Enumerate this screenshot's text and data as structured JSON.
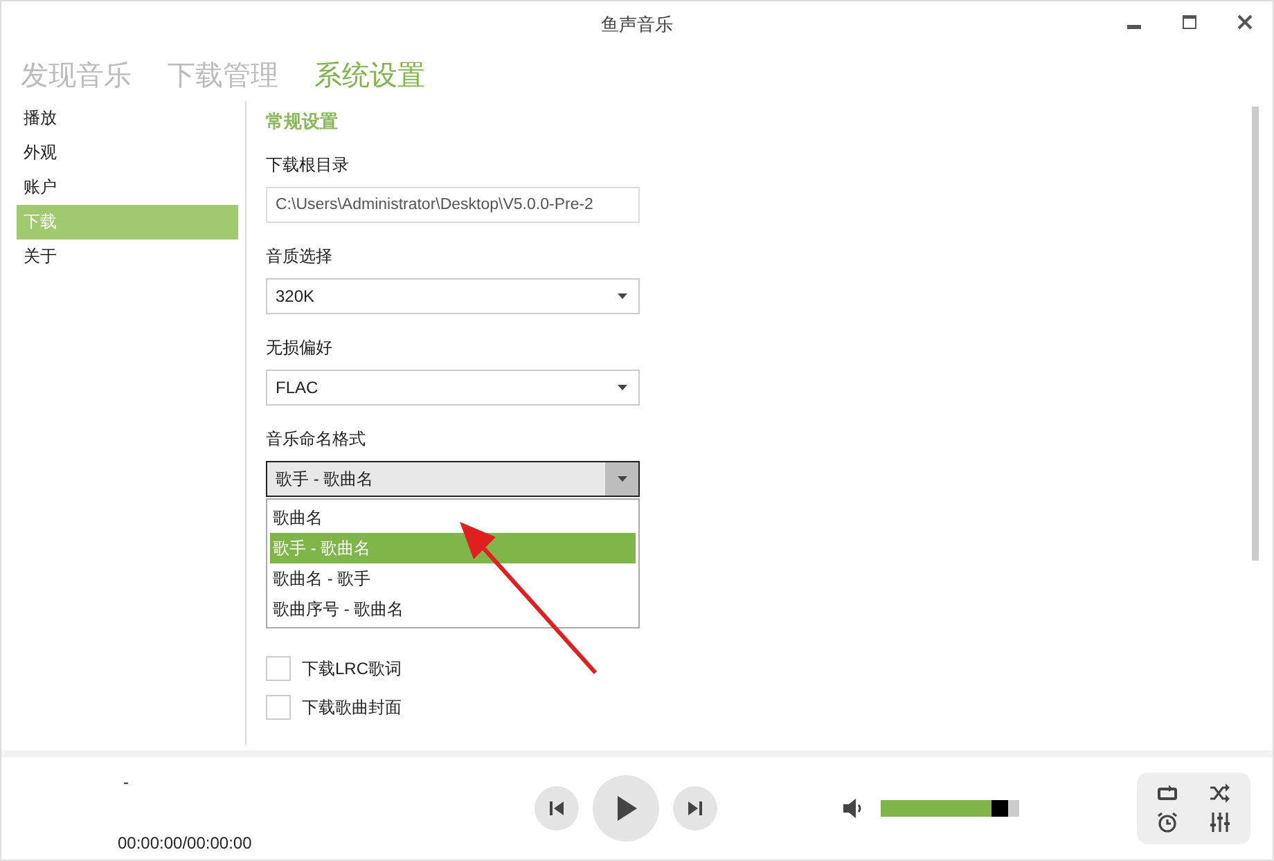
{
  "window": {
    "title": "鱼声音乐"
  },
  "tabs": [
    {
      "label": "发现音乐",
      "selected": false
    },
    {
      "label": "下载管理",
      "selected": false
    },
    {
      "label": "系统设置",
      "selected": true
    }
  ],
  "sidebar": {
    "items": [
      {
        "label": "播放",
        "selected": false
      },
      {
        "label": "外观",
        "selected": false
      },
      {
        "label": "账户",
        "selected": false
      },
      {
        "label": "下载",
        "selected": true
      },
      {
        "label": "关于",
        "selected": false
      }
    ]
  },
  "settings": {
    "section_title": "常规设置",
    "fields": [
      {
        "kind": "text",
        "label": "下载根目录",
        "value": "C:\\Users\\Administrator\\Desktop\\V5.0.0-Pre-2"
      },
      {
        "kind": "select",
        "label": "音质选择",
        "value": "320K",
        "expanded": false
      },
      {
        "kind": "select",
        "label": "无损偏好",
        "value": "FLAC",
        "expanded": false
      },
      {
        "kind": "select",
        "label": "音乐命名格式",
        "value": "歌手 - 歌曲名",
        "expanded": true,
        "options": [
          {
            "label": "歌曲名",
            "selected": false
          },
          {
            "label": "歌手 - 歌曲名",
            "selected": true
          },
          {
            "label": "歌曲名 - 歌手",
            "selected": false
          },
          {
            "label": "歌曲序号 - 歌曲名",
            "selected": false
          }
        ]
      }
    ],
    "checkboxes": [
      {
        "label": "下载LRC歌词",
        "checked": false
      },
      {
        "label": "下载歌曲封面",
        "checked": false
      }
    ]
  },
  "player": {
    "title": "-",
    "time": "00:00:00/00:00:00",
    "volume": {
      "level": 0.8
    }
  }
}
